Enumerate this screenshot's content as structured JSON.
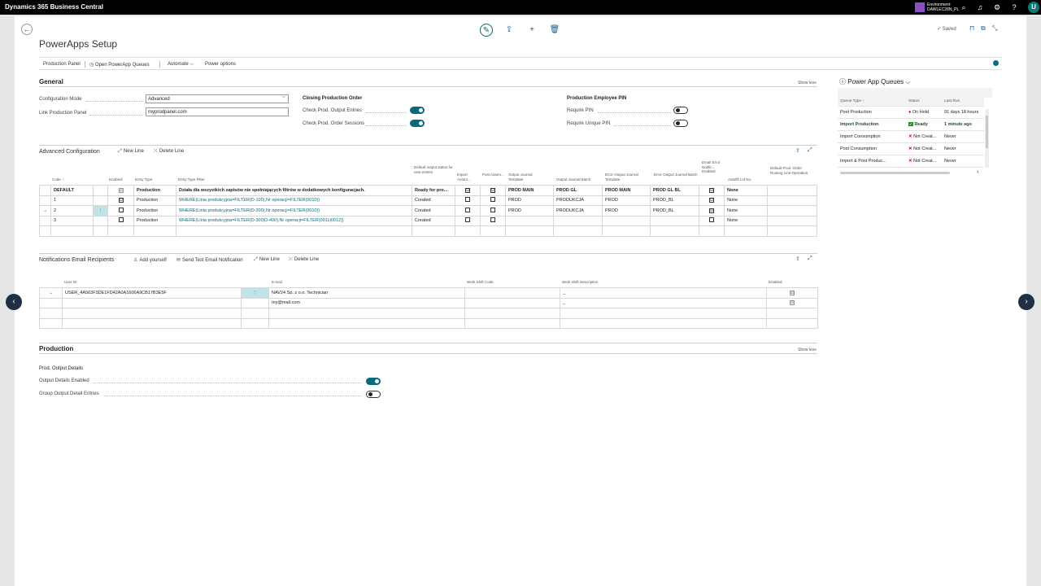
{
  "topbar": {
    "app_title": "Dynamics 365 Business Central",
    "env_label": "Environment:",
    "env_name": "DAWLEC28N_PL",
    "avatar": "U"
  },
  "page": {
    "title": "PowerApps Setup",
    "saved": "Saved"
  },
  "actions": [
    "Production Panel",
    "Open PowerApp Queues",
    "Automate",
    "Power options"
  ],
  "general": {
    "title": "General",
    "show_less": "Show less",
    "config_mode_label": "Configuration Mode",
    "config_mode_value": "Advanced",
    "link_panel_label": "Link Production Panel",
    "link_panel_value": "myprodpanel.com",
    "closing_title": "Closing Production Order",
    "check_output_label": "Check Prod. Output Entries",
    "check_sessions_label": "Check Prod. Order Sessions",
    "pin_title": "Production Employee PIN",
    "require_pin_label": "Require PIN",
    "require_unique_pin_label": "Require Unique PIN"
  },
  "advanced": {
    "title": "Advanced Configuration",
    "new_line": "New Line",
    "delete_line": "Delete Line",
    "headers": [
      "Code ↑",
      "Enabled",
      "Entry Type",
      "Entry Type Filter",
      "Default output status for new entries",
      "Import Autom...",
      "Post Autom...",
      "Output Journal Template",
      "Output Journal Batch",
      "Error Output Journal Template",
      "Error Output Journal Batch",
      "Email Error Notific... Enabled",
      "Autofill Lot No.",
      "Default Prod. Order Routing Line Operation"
    ],
    "rows": [
      {
        "arrow": "",
        "code": "DEFAULT",
        "enabled": "☑",
        "type": "Production",
        "filter": "Działa dla wszystkich zapisów nie spełniających filtrów w dodatkowych konfiguracjach.",
        "status": "Ready for pro...",
        "import": "☑",
        "post": "☑",
        "ojt": "PROD MAIN",
        "ojb": "PROD GL",
        "eojt": "PROD MAIN",
        "eojb": "PROD GL BL",
        "email": "☑",
        "lot": "None",
        "op": ""
      },
      {
        "arrow": "",
        "code": "1",
        "enabled": "☑",
        "type": "Production",
        "filter": "WHERE(Linia produkcyjna=FILTER(D-100),Nr operacji=FILTER(0010))",
        "status": "Created",
        "import": "",
        "post": "",
        "ojt": "PROD",
        "ojb": "PRODUKCJA",
        "eojt": "PROD",
        "eojb": "PROD_BL",
        "email": "☑",
        "lot": "None",
        "op": ""
      },
      {
        "arrow": "→",
        "code": "2",
        "enabled": "",
        "type": "Production",
        "filter": "WHERE(Linia produkcyjna=FILTER(D-200),Nr operacji=FILTER(0010))",
        "status": "Created",
        "import": "",
        "post": "",
        "ojt": "PROD",
        "ojb": "PRODUKCJA",
        "eojt": "PROD",
        "eojb": "PROD_BL",
        "email": "☑",
        "lot": "None",
        "op": ""
      },
      {
        "arrow": "",
        "code": "3",
        "enabled": "",
        "type": "Production",
        "filter": "WHERE(Linia produkcyjna=FILTER(D-300|D-400),Nr operacji=FILTER(0011|0012))",
        "status": "Created",
        "import": "",
        "post": "",
        "ojt": "",
        "ojb": "",
        "eojt": "",
        "eojb": "",
        "email": "",
        "lot": "None",
        "op": ""
      }
    ]
  },
  "notifications": {
    "title": "Notifications Email Recipients",
    "add_yourself": "Add yourself",
    "send_test": "Send Test Email Notification",
    "new_line": "New Line",
    "delete_line": "Delete Line",
    "headers": [
      "User ID",
      "E-mail",
      "Work Shift Code",
      "Work Shift Description",
      "Enabled"
    ],
    "rows": [
      {
        "arrow": "→",
        "user": "USER_4A563F3DE1FD42A0A1606A9CB17B3E5F",
        "email": "NAV24 Sp. z o.o. Technician",
        "code": "",
        "desc": "_",
        "enabled": "☑"
      },
      {
        "arrow": "",
        "user": "",
        "email": "my@mail.com",
        "code": "",
        "desc": "_",
        "enabled": "☑"
      }
    ]
  },
  "production": {
    "title": "Production",
    "show_less": "Show less",
    "subtitle": "Prod. Output Details",
    "output_enabled_label": "Output Details Enabled",
    "group_output_label": "Group Output Detail Entries"
  },
  "factbox": {
    "title": "Power App Queues",
    "headers": [
      "Queue Type ↑",
      "Status",
      "Last Run"
    ],
    "rows": [
      {
        "type": "Post Production",
        "status_icon": "●",
        "status": "On Hold",
        "last": "91 days 18 hours",
        "bold": false,
        "kind": "hold"
      },
      {
        "type": "Import Production",
        "status_icon": "✓",
        "status": "Ready",
        "last": "1 minute ago",
        "bold": true,
        "kind": "ready"
      },
      {
        "type": "Import Consumption",
        "status_icon": "✕",
        "status": "Not Creat...",
        "last": "Never",
        "bold": false,
        "kind": "no"
      },
      {
        "type": "Post Consumption",
        "status_icon": "✕",
        "status": "Not Creat...",
        "last": "Never",
        "bold": false,
        "kind": "no"
      },
      {
        "type": "Import & Post Produc...",
        "status_icon": "✕",
        "status": "Not Creat...",
        "last": "Never",
        "bold": false,
        "kind": "no"
      }
    ]
  }
}
